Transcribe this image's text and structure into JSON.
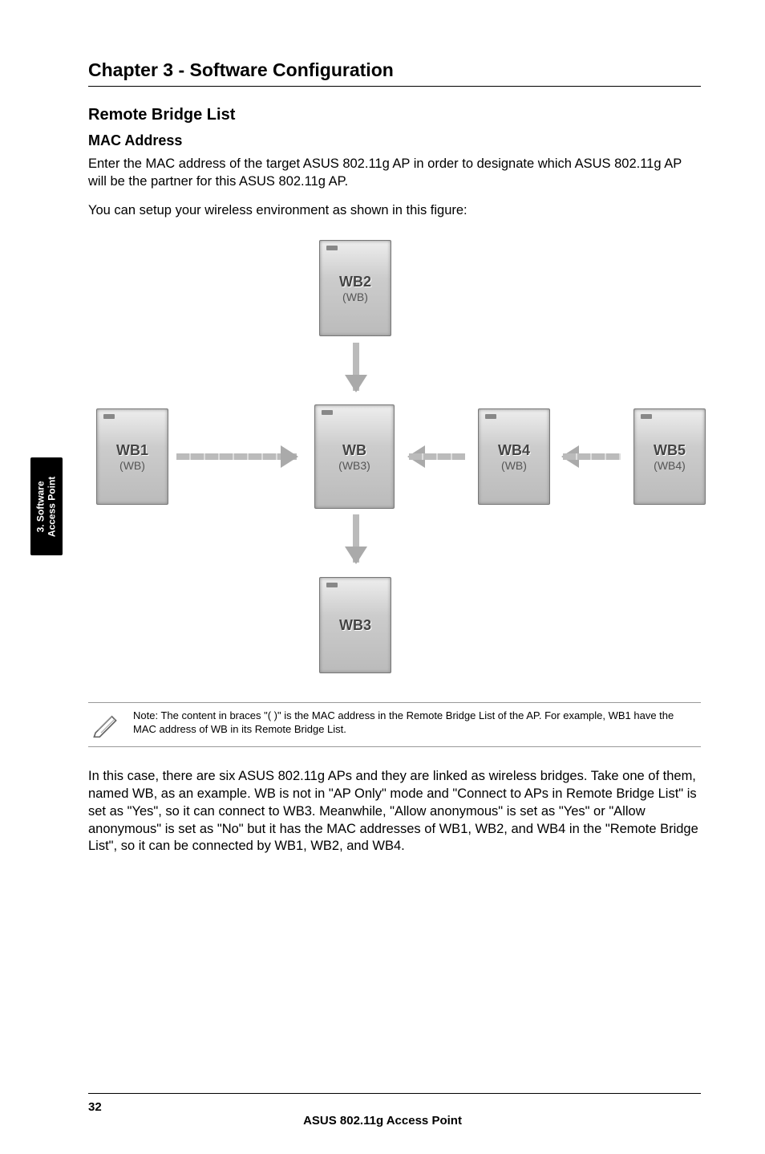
{
  "chapter_title": "Chapter 3 - Software Configuration",
  "section": {
    "title": "Remote Bridge List",
    "sub_title": "MAC Address",
    "para1": "Enter the MAC address of the target ASUS 802.11g AP in order to designate which ASUS 802.11g AP will be the partner for this ASUS 802.11g AP.",
    "para2": "You can setup your wireless environment as shown in this figure:"
  },
  "diagram": {
    "nodes": {
      "wb1": {
        "label": "WB1",
        "sub": "(WB)"
      },
      "wb2": {
        "label": "WB2",
        "sub": "(WB)"
      },
      "wb": {
        "label": "WB",
        "sub": "(WB3)"
      },
      "wb3": {
        "label": "WB3",
        "sub": ""
      },
      "wb4": {
        "label": "WB4",
        "sub": "(WB)"
      },
      "wb5": {
        "label": "WB5",
        "sub": "(WB4)"
      }
    }
  },
  "note": "Note: The content in braces \"( )\" is the MAC address in the Remote Bridge List of the AP. For example, WB1 have the MAC address of WB in its Remote Bridge List.",
  "body_para": "In this case, there are six ASUS 802.11g APs and they are linked as wireless bridges. Take one of them, named WB, as an example. WB is not in \"AP Only\" mode and \"Connect to APs in Remote Bridge List\" is set as \"Yes\", so it can connect to WB3. Meanwhile, \"Allow anonymous\" is set as \"Yes\" or \"Allow anonymous\" is set as \"No\" but it has the MAC addresses of WB1, WB2, and WB4 in the \"Remote Bridge List\", so it can be connected by WB1, WB2, and WB4.",
  "side_tab": {
    "line1": "3. Software",
    "line2": "Access Point"
  },
  "footer": {
    "page": "32",
    "title": "ASUS 802.11g Access Point"
  }
}
